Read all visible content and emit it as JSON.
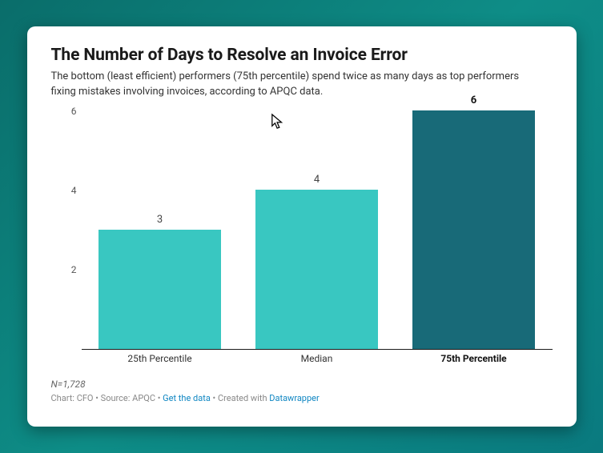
{
  "title": "The Number of Days to Resolve an Invoice Error",
  "subtitle": "The bottom (least efficient) performers (75th percentile) spend twice as many days as top performers fixing mistakes involving invoices, according to APQC data.",
  "footnote": "N=1,728",
  "credits": {
    "prefix": "Chart: CFO • Source: APQC • ",
    "link1_label": "Get the data",
    "middle": " • Created with ",
    "link2_label": "Datawrapper"
  },
  "chart_data": {
    "type": "bar",
    "categories": [
      "25th Percentile",
      "Median",
      "75th Percentile"
    ],
    "values": [
      3,
      4,
      6
    ],
    "highlighted_index": 2,
    "title": "The Number of Days to Resolve an Invoice Error",
    "xlabel": "",
    "ylabel": "",
    "ylim": [
      0,
      6
    ],
    "y_ticks": [
      2,
      4,
      6
    ],
    "colors": {
      "normal": "#39c7c1",
      "highlight": "#186a78"
    }
  }
}
